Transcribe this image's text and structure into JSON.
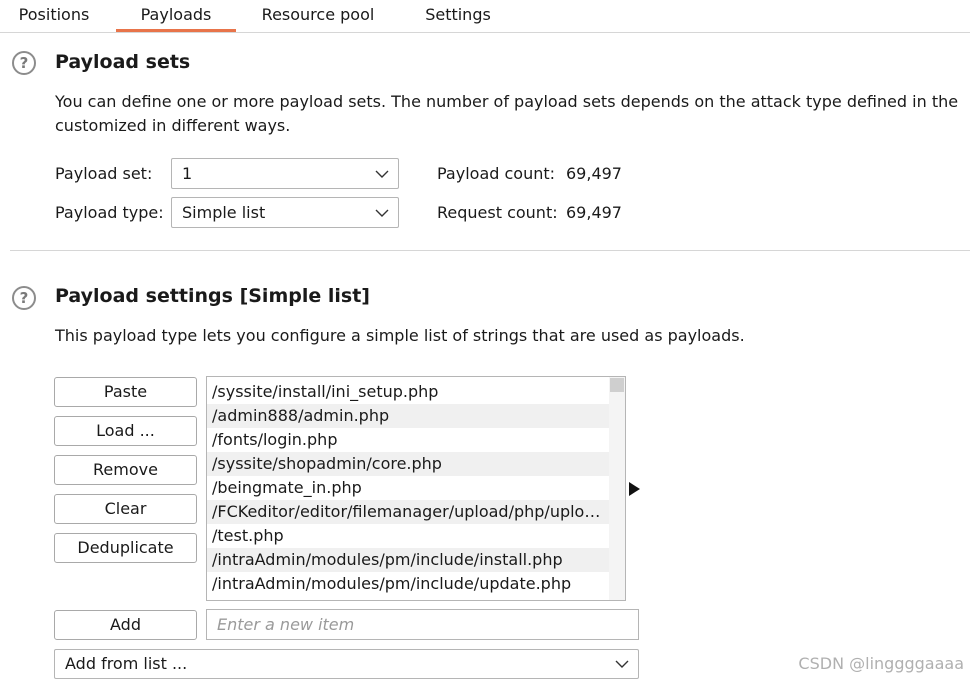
{
  "tabs": [
    {
      "label": "Positions"
    },
    {
      "label": "Payloads",
      "active": true
    },
    {
      "label": "Resource pool"
    },
    {
      "label": "Settings"
    }
  ],
  "payload_sets": {
    "help_icon": "question-mark-icon",
    "title": "Payload sets",
    "description_line1": "You can define one or more payload sets. The number of payload sets depends on the attack type defined in the",
    "description_line2": "customized in different ways.",
    "set_label": "Payload set:",
    "set_value": "1",
    "type_label": "Payload type:",
    "type_value": "Simple list",
    "payload_count_label": "Payload count:",
    "payload_count_value": "69,497",
    "request_count_label": "Request count:",
    "request_count_value": "69,497"
  },
  "payload_settings": {
    "help_icon": "question-mark-icon",
    "title": "Payload settings [Simple list]",
    "description": "This payload type lets you configure a simple list of strings that are used as payloads.",
    "buttons": {
      "paste": "Paste",
      "load": "Load ...",
      "remove": "Remove",
      "clear": "Clear",
      "deduplicate": "Deduplicate",
      "add": "Add"
    },
    "items": [
      "/syssite/install/ini_setup.php",
      "/admin888/admin.php",
      "/fonts/login.php",
      "/syssite/shopadmin/core.php",
      "/beingmate_in.php",
      "/FCKeditor/editor/filemanager/upload/php/upload.php",
      "/test.php",
      "/intraAdmin/modules/pm/include/install.php",
      "/intraAdmin/modules/pm/include/update.php"
    ],
    "add_input_placeholder": "Enter a new item",
    "add_from_list_value": "Add from list ..."
  },
  "watermark": "CSDN @linggggaaaa",
  "colors": {
    "tab_accent": "#e8744a",
    "row_alt": "#f0f0f0",
    "border": "#b5b5b5"
  }
}
